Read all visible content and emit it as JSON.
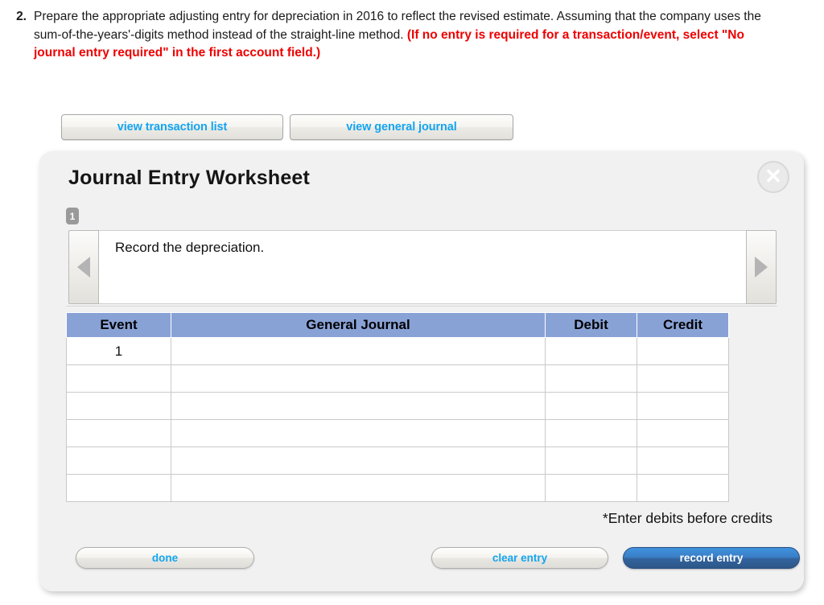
{
  "question": {
    "number": "2.",
    "body": "Prepare the appropriate adjusting entry for depreciation in 2016 to reflect the revised estimate. Assuming that the company uses the sum-of-the-years'-digits method instead of the straight-line method. ",
    "note": "(If no entry is required for a transaction/event, select \"No journal entry required\" in the first account field.)"
  },
  "top_buttons": {
    "view_transaction_list": "view transaction list",
    "view_general_journal": "view general journal"
  },
  "panel": {
    "title": "Journal Entry Worksheet",
    "close_icon": "close-icon",
    "close_glyph": "✕",
    "tabs": [
      {
        "label": "1",
        "selected": true
      }
    ],
    "nav": {
      "prev_icon": "chevron-left-icon",
      "next_icon": "chevron-right-icon",
      "description": "Record the depreciation."
    },
    "table": {
      "columns": [
        "Event",
        "General Journal",
        "Debit",
        "Credit"
      ],
      "rows": [
        {
          "event": "1",
          "general_journal": "",
          "debit": "",
          "credit": ""
        },
        {
          "event": "",
          "general_journal": "",
          "debit": "",
          "credit": ""
        },
        {
          "event": "",
          "general_journal": "",
          "debit": "",
          "credit": ""
        },
        {
          "event": "",
          "general_journal": "",
          "debit": "",
          "credit": ""
        },
        {
          "event": "",
          "general_journal": "",
          "debit": "",
          "credit": ""
        },
        {
          "event": "",
          "general_journal": "",
          "debit": "",
          "credit": ""
        }
      ]
    },
    "note": "*Enter debits before credits",
    "actions": {
      "done": "done",
      "clear_entry": "clear entry",
      "record_entry": "record entry"
    }
  },
  "colors": {
    "link_text": "#14a5ef",
    "alert_text": "#ee0000",
    "table_header_bg": "#89a2d6",
    "field_border": "#f5f016",
    "primary_button": "#3a7fc6",
    "panel_bg": "#f1f1f1"
  }
}
